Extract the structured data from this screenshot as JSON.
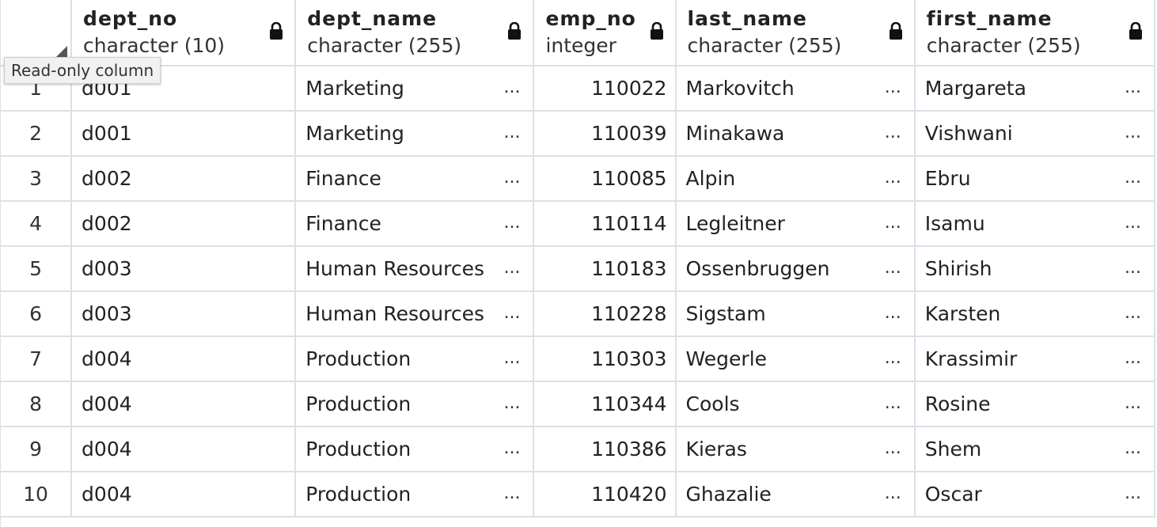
{
  "columns": [
    {
      "name": "dept_no",
      "type": "character (10)"
    },
    {
      "name": "dept_name",
      "type": "character (255)"
    },
    {
      "name": "emp_no",
      "type": "integer"
    },
    {
      "name": "last_name",
      "type": "character (255)"
    },
    {
      "name": "first_name",
      "type": "character (255)"
    }
  ],
  "tooltip": "Read-only column",
  "ellipsis": "...",
  "rows": [
    {
      "n": "1",
      "dept_no": "d001",
      "dept_name": "Marketing",
      "emp_no": "110022",
      "last_name": "Markovitch",
      "first_name": "Margareta"
    },
    {
      "n": "2",
      "dept_no": "d001",
      "dept_name": "Marketing",
      "emp_no": "110039",
      "last_name": "Minakawa",
      "first_name": "Vishwani"
    },
    {
      "n": "3",
      "dept_no": "d002",
      "dept_name": "Finance",
      "emp_no": "110085",
      "last_name": "Alpin",
      "first_name": "Ebru"
    },
    {
      "n": "4",
      "dept_no": "d002",
      "dept_name": "Finance",
      "emp_no": "110114",
      "last_name": "Legleitner",
      "first_name": "Isamu"
    },
    {
      "n": "5",
      "dept_no": "d003",
      "dept_name": "Human Resources",
      "emp_no": "110183",
      "last_name": "Ossenbruggen",
      "first_name": "Shirish"
    },
    {
      "n": "6",
      "dept_no": "d003",
      "dept_name": "Human Resources",
      "emp_no": "110228",
      "last_name": "Sigstam",
      "first_name": "Karsten"
    },
    {
      "n": "7",
      "dept_no": "d004",
      "dept_name": "Production",
      "emp_no": "110303",
      "last_name": "Wegerle",
      "first_name": "Krassimir"
    },
    {
      "n": "8",
      "dept_no": "d004",
      "dept_name": "Production",
      "emp_no": "110344",
      "last_name": "Cools",
      "first_name": "Rosine"
    },
    {
      "n": "9",
      "dept_no": "d004",
      "dept_name": "Production",
      "emp_no": "110386",
      "last_name": "Kieras",
      "first_name": "Shem"
    },
    {
      "n": "10",
      "dept_no": "d004",
      "dept_name": "Production",
      "emp_no": "110420",
      "last_name": "Ghazalie",
      "first_name": "Oscar"
    }
  ]
}
